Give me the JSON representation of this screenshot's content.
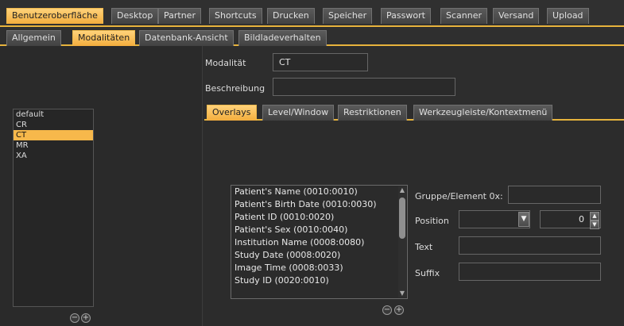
{
  "top_tabs": [
    "Benutzeroberfläche",
    "Desktop",
    "Partner",
    "Shortcuts",
    "Drucken",
    "Speicher",
    "Passwort",
    "Scanner",
    "Versand",
    "Upload"
  ],
  "sub_tabs": [
    "Allgemein",
    "Modalitäten",
    "Datenbank-Ansicht",
    "Bildladeverhalten"
  ],
  "modalities": [
    "default",
    "CR",
    "CT",
    "MR",
    "XA"
  ],
  "selected_modality": "CT",
  "form": {
    "modalitaet_label": "Modalität",
    "modalitaet_value": "CT",
    "beschreibung_label": "Beschreibung",
    "beschreibung_value": ""
  },
  "inner_tabs": [
    "Overlays",
    "Level/Window",
    "Restriktionen",
    "Werkzeugleiste/Kontextmenü"
  ],
  "overlay_items": [
    "Patient's Name (0010:0010)",
    "Patient's Birth Date (0010:0030)",
    "Patient ID (0010:0020)",
    "Patient's Sex (0010:0040)",
    "Institution Name (0008:0080)",
    "Study Date (0008:0020)",
    "Image Time (0008:0033)",
    "Study ID (0020:0010)"
  ],
  "overlay_props": {
    "gruppe_label": "Gruppe/Element 0x:",
    "gruppe_value": "",
    "position_label": "Position",
    "position_value": "",
    "position_number": "0",
    "text_label": "Text",
    "text_value": "",
    "suffix_label": "Suffix",
    "suffix_value": ""
  },
  "buttons": {
    "remove": "−",
    "add": "+"
  },
  "colors": {
    "accent": "#f3ad3d",
    "background": "#2d2d2d"
  }
}
